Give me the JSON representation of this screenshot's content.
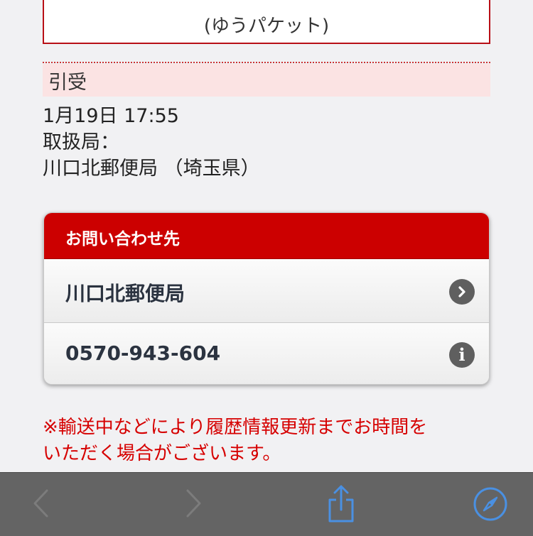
{
  "service": {
    "name": "(ゆうパケット)"
  },
  "tracking": {
    "status": "引受",
    "datetime": "1月19日 17:55",
    "office_label": "取扱局：",
    "office_name": "川口北郵便局 （埼玉県）"
  },
  "contact": {
    "title": "お問い合わせ先",
    "office": "川口北郵便局",
    "phone": "0570-943-604"
  },
  "notice": {
    "line1": "※輸送中などにより履歴情報更新までお時間を",
    "line2": "いただく場合がございます。"
  },
  "toolbar": {
    "icons": [
      "back-icon",
      "forward-icon",
      "share-icon",
      "compass-icon"
    ],
    "accent_color": "#4a90e2",
    "disabled_color": "#7c7c7c"
  },
  "colors": {
    "brand_red": "#cc0000",
    "notice_red": "#d60000",
    "status_bg": "#fbe3e3"
  }
}
